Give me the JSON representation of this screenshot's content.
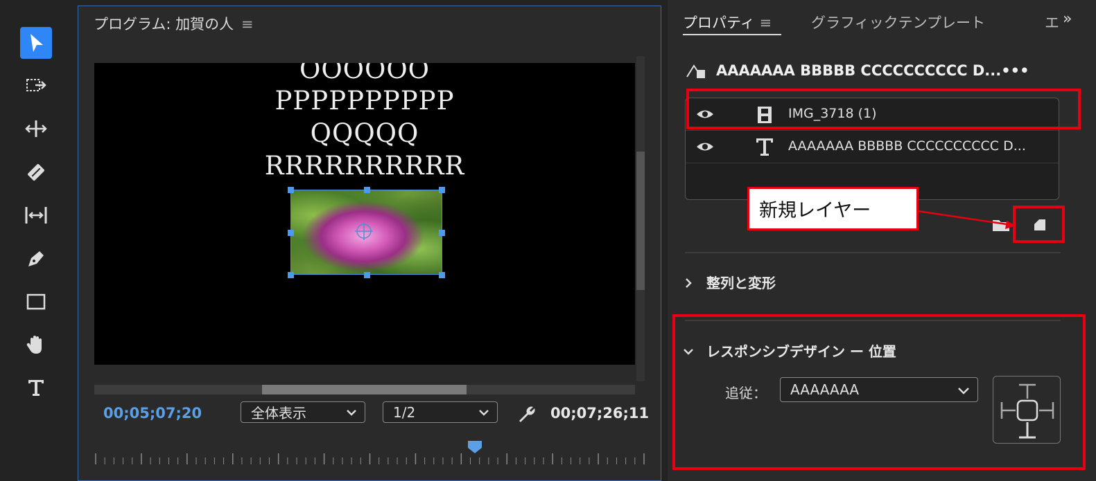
{
  "toolbar": {
    "tools": [
      {
        "name": "selection-tool",
        "icon": "arrow-icon",
        "active": true
      },
      {
        "name": "track-select-forward-tool",
        "icon": "track-select-icon"
      },
      {
        "name": "ripple-edit-tool",
        "icon": "ripple-edit-icon"
      },
      {
        "name": "razor-tool",
        "icon": "razor-icon"
      },
      {
        "name": "slip-tool",
        "icon": "slip-icon"
      },
      {
        "name": "pen-tool",
        "icon": "pen-icon"
      },
      {
        "name": "rectangle-tool",
        "icon": "rectangle-icon"
      },
      {
        "name": "hand-tool",
        "icon": "hand-icon"
      },
      {
        "name": "type-tool",
        "icon": "type-icon"
      }
    ]
  },
  "monitor": {
    "title": "プログラム: 加賀の人",
    "menu_glyph": "≡",
    "video_text": [
      "OOOOOO",
      "PPPPPPPPPP",
      "QQQQQ",
      "RRRRRRRRRR"
    ],
    "current_timecode": "00;05;07;20",
    "zoom_select": "全体表示",
    "resolution_select": "1/2",
    "duration_timecode": "00;07;26;11",
    "playhead_position": 0.69
  },
  "properties": {
    "tabs": [
      {
        "label": "プロパティ",
        "active": true
      },
      {
        "label": "グラフィックテンプレート"
      },
      {
        "label": "エ"
      }
    ],
    "tab_menu_glyph": "≡",
    "overflow_glyph": "»",
    "clip_title": "AAAAAAA BBBBB CCCCCCCCCC D...",
    "clip_menu": "•••",
    "layers": [
      {
        "name": "IMG_3718 (1)",
        "type": "film-icon",
        "visible": true
      },
      {
        "name": "AAAAAAA BBBBB CCCCCCCCCC D...",
        "type": "T",
        "visible": true
      }
    ],
    "align_section": "整列と変形",
    "responsive_section": "レスポンシブデザイン ー 位置",
    "follow_label": "追従：",
    "follow_value": "AAAAAAA"
  },
  "annotation": {
    "callout_text": "新規レイヤー",
    "color": "#e60012"
  },
  "colors": {
    "accent": "#2f86f6",
    "timecode": "#5b9fe6",
    "highlight": "#e60012"
  }
}
